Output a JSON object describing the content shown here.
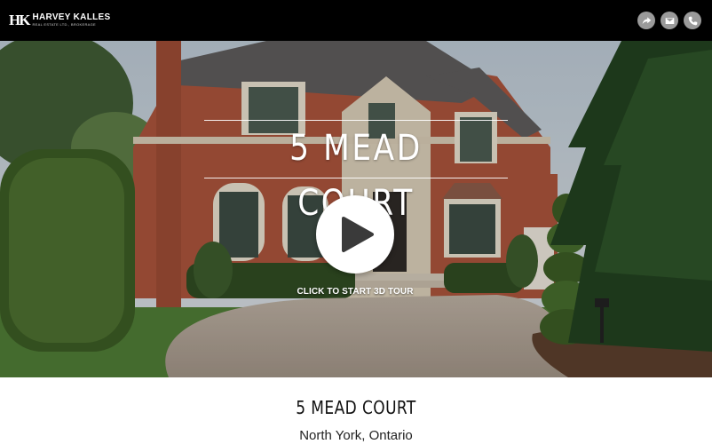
{
  "brand": {
    "logo_mark": "HK",
    "name": "HARVEY KALLES",
    "subtitle": "REAL ESTATE LTD., BROKERAGE"
  },
  "header_actions": [
    {
      "icon": "share-icon"
    },
    {
      "icon": "envelope-icon"
    },
    {
      "icon": "phone-icon"
    }
  ],
  "hero": {
    "title": "5 MEAD COURT",
    "cta_label": "CLICK TO START 3D TOUR"
  },
  "property": {
    "title": "5 MEAD COURT",
    "location": "North York, Ontario"
  },
  "colors": {
    "topbar": "#000000",
    "icon_button": "#9a9a9a",
    "brick": "#a8533b"
  }
}
